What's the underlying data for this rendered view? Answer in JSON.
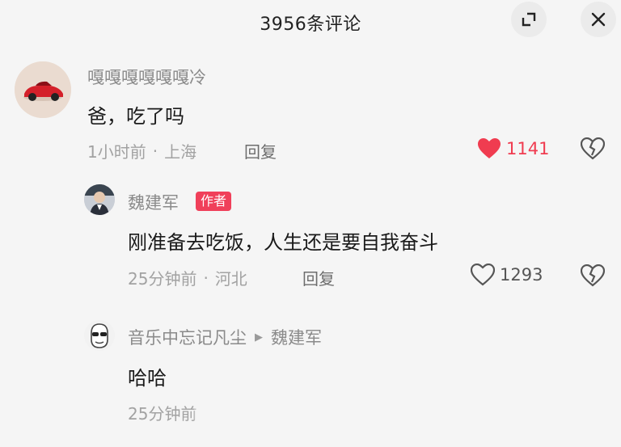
{
  "header": {
    "title": "3956条评论",
    "expand_icon": "expand-icon",
    "close_icon": "close-icon"
  },
  "comments": [
    {
      "user": "嘎嘎嘎嘎嘎嘎冷",
      "text": "爸，吃了吗",
      "time": "1小时前",
      "location": "上海",
      "reply_label": "回复",
      "likes": "1141",
      "liked": true,
      "like_color": "#f03c50"
    },
    {
      "user": "魏建军",
      "badge": "作者",
      "text": "刚准备去吃饭，人生还是要自我奋斗",
      "time": "25分钟前",
      "location": "河北",
      "reply_label": "回复",
      "likes": "1293",
      "liked": false
    },
    {
      "user": "音乐中忘记凡尘",
      "reply_to": "魏建军",
      "text": "哈哈",
      "time": "25分钟前"
    }
  ]
}
